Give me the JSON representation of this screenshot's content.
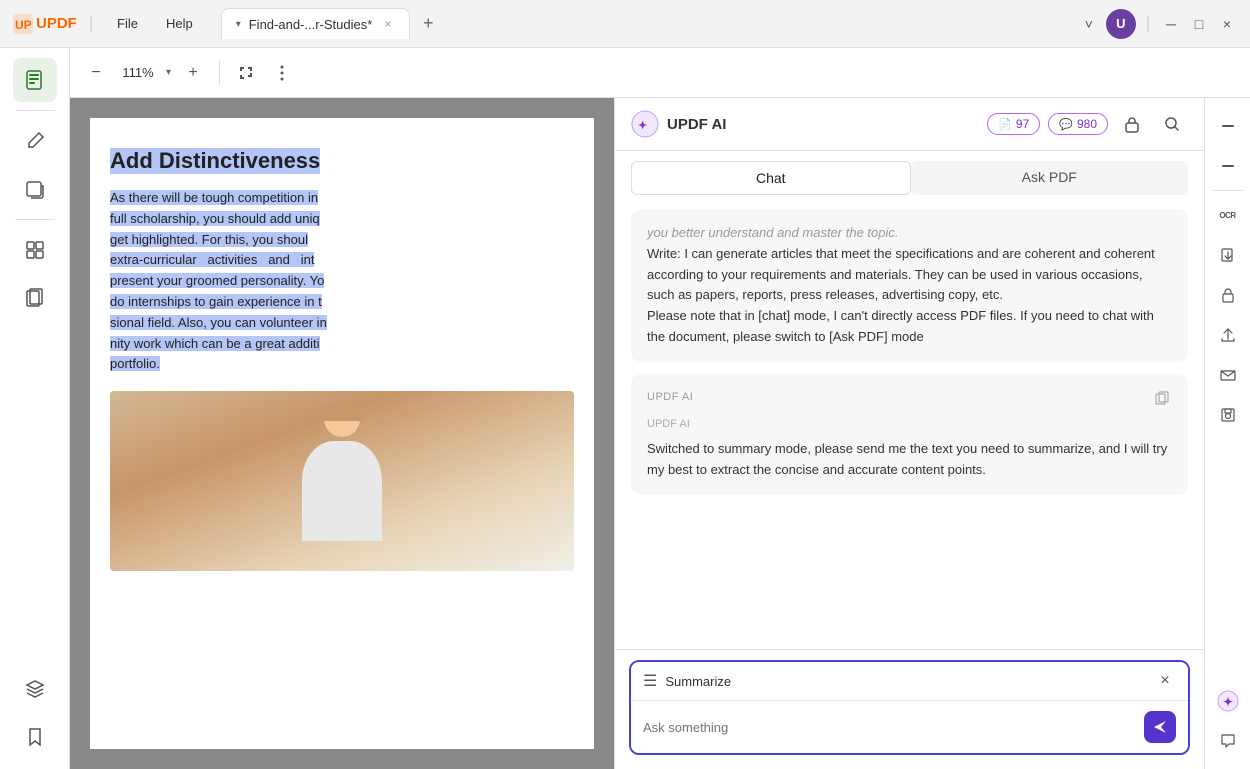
{
  "titlebar": {
    "logo": "UPDF",
    "menu": [
      "File",
      "Help"
    ],
    "tab": {
      "arrow": "▾",
      "name": "Find-and-...r-Studies*",
      "close": "×"
    },
    "tab_add": "+",
    "tab_dropdown": "˅",
    "avatar": "U",
    "controls": {
      "minimize": "─",
      "maximize": "□",
      "close": "×"
    }
  },
  "toolbar": {
    "zoom_out": "−",
    "zoom_value": "111%",
    "zoom_arrow": "▾",
    "zoom_in": "+",
    "fit_page": "⊠",
    "more": "⋮"
  },
  "left_sidebar": {
    "icons": [
      {
        "name": "document-view-icon",
        "symbol": "📄",
        "active": true
      },
      {
        "name": "edit-icon",
        "symbol": "✏️",
        "active": false
      },
      {
        "name": "annotate-icon",
        "symbol": "📝",
        "active": false
      },
      {
        "name": "organize-icon",
        "symbol": "🗂️",
        "active": false
      },
      {
        "name": "pages-icon",
        "symbol": "📋",
        "active": false
      },
      {
        "name": "layers-icon",
        "symbol": "🗃️",
        "active": false
      },
      {
        "name": "bookmark-icon",
        "symbol": "🔖",
        "active": false
      }
    ],
    "bottom_icons": [
      {
        "name": "layers-bottom-icon",
        "symbol": "⧉"
      }
    ]
  },
  "pdf": {
    "heading": "Add Distinctiveness",
    "paragraphs": [
      "As there will be tough competition in",
      "full scholarship, you should add uniq",
      "get highlighted. For this, you shoul",
      "extra-curricular  activities  and  int",
      "present your groomed personality. Yo",
      "do internships to gain experience in t",
      "sional field. Also, you can volunteer i",
      "nity work which can be a great additi",
      "portfolio."
    ]
  },
  "ai_panel": {
    "logo_text": "UPDF AI",
    "credits": {
      "pages_count": "97",
      "messages_count": "980"
    },
    "tabs": {
      "chat": "Chat",
      "ask_pdf": "Ask PDF",
      "active": "chat"
    },
    "messages": [
      {
        "id": "msg1",
        "type": "ai",
        "label": "",
        "text": "you better understand and master the topic.\nWrite: I can generate articles that meet the specifications and are coherent and coherent according to your requirements and materials. They can be used in various occasions, such as papers, reports, press releases, advertising copy, etc.\nPlease note that in [chat] mode, I can't directly access PDF files. If you need to chat with the document, please switch to [Ask PDF] mode"
      },
      {
        "id": "msg2",
        "type": "ai",
        "label": "UPDF AI",
        "text": "Switched to summary mode, please send me the text you need to summarize, and I will try my best to extract the concise and accurate content points."
      }
    ],
    "input": {
      "mode_icon": "☰",
      "mode_label": "Summarize",
      "close_icon": "×",
      "placeholder": "Ask something",
      "send_icon": "➤"
    }
  },
  "right_sidebar": {
    "icons": [
      {
        "name": "scroll-up-icon",
        "symbol": "−"
      },
      {
        "name": "scroll-down-icon",
        "symbol": "−"
      },
      {
        "name": "ocr-icon",
        "symbol": "OCR"
      },
      {
        "name": "page-extract-icon",
        "symbol": "📄"
      },
      {
        "name": "protect-icon",
        "symbol": "🔒"
      },
      {
        "name": "share-icon",
        "symbol": "↑"
      },
      {
        "name": "email-icon",
        "symbol": "✉"
      },
      {
        "name": "save-icon",
        "symbol": "💾"
      },
      {
        "name": "updf-icon-bottom",
        "symbol": "✦"
      },
      {
        "name": "comment-icon",
        "symbol": "💬"
      }
    ]
  }
}
